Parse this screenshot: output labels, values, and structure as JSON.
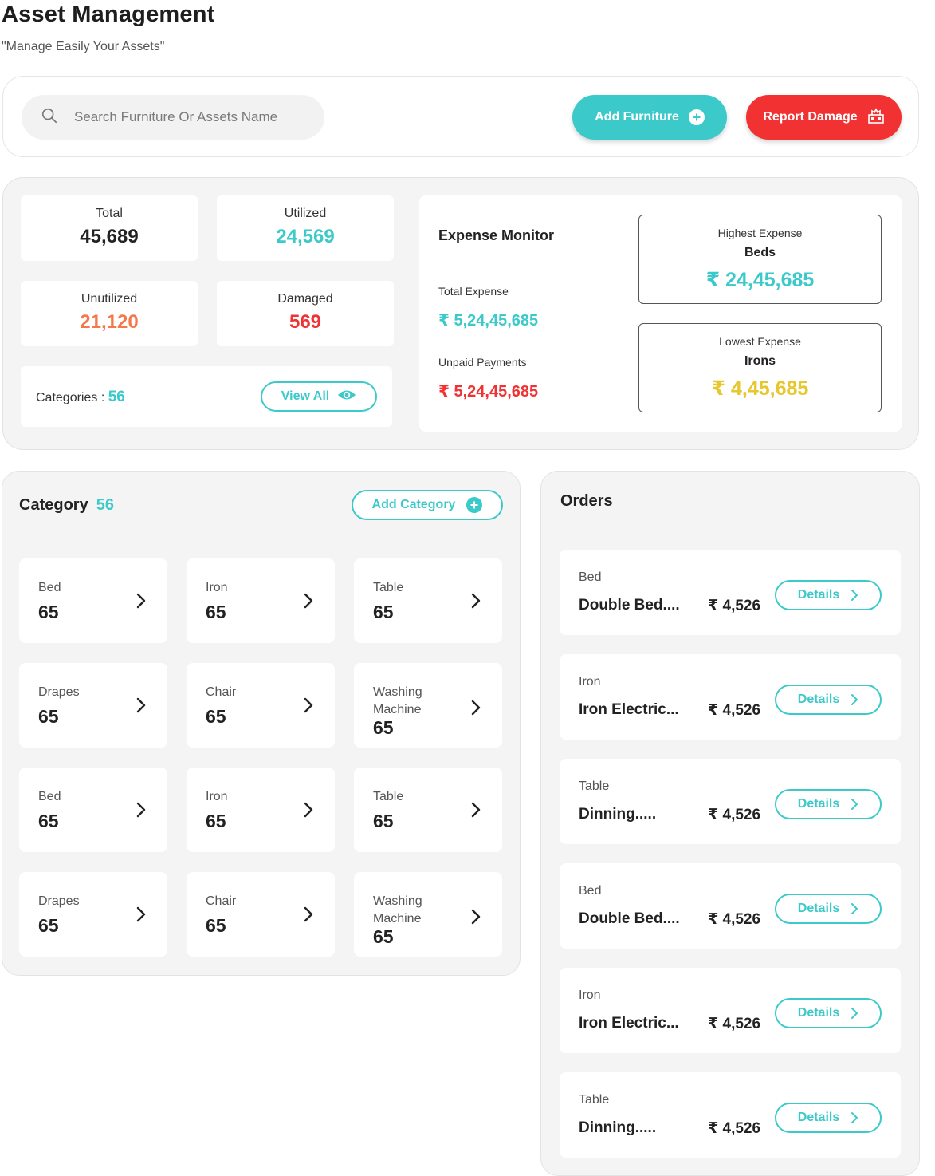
{
  "header": {
    "title": "Asset Management",
    "subtitle": "\"Manage Easily Your Assets\""
  },
  "toolbar": {
    "search_placeholder": "Search Furniture Or Assets Name",
    "add_furniture_label": "Add Furniture",
    "report_damage_label": "Report Damage"
  },
  "stats": {
    "total": {
      "label": "Total",
      "value": "45,689",
      "color": "#222222"
    },
    "utilized": {
      "label": "Utilized",
      "value": "24,569",
      "color": "#3cc9c9"
    },
    "unutilized": {
      "label": "Unutilized",
      "value": "21,120",
      "color": "#f5784a"
    },
    "damaged": {
      "label": "Damaged",
      "value": "569",
      "color": "#f23232"
    },
    "categories_label": "Categories : ",
    "categories_count": "56",
    "view_all_label": "View All"
  },
  "expense": {
    "title": "Expense Monitor",
    "total_label": "Total Expense",
    "total_value": "₹ 5,24,45,685",
    "unpaid_label": "Unpaid Payments",
    "unpaid_value": "₹ 5,24,45,685",
    "highest": {
      "label": "Highest Expense",
      "item": "Beds",
      "value": "₹ 24,45,685",
      "color": "#3cc9c9"
    },
    "lowest": {
      "label": "Lowest Expense",
      "item": "Irons",
      "value": "₹ 4,45,685",
      "color": "#e6c72e"
    }
  },
  "category": {
    "title": "Category",
    "count": "56",
    "add_label": "Add Category",
    "items": [
      {
        "name": "Bed",
        "count": "65"
      },
      {
        "name": "Iron",
        "count": "65"
      },
      {
        "name": "Table",
        "count": "65"
      },
      {
        "name": "Drapes",
        "count": "65"
      },
      {
        "name": "Chair",
        "count": "65"
      },
      {
        "name": "Washing Machine",
        "count": "65"
      },
      {
        "name": "Bed",
        "count": "65"
      },
      {
        "name": "Iron",
        "count": "65"
      },
      {
        "name": "Table",
        "count": "65"
      },
      {
        "name": "Drapes",
        "count": "65"
      },
      {
        "name": "Chair",
        "count": "65"
      },
      {
        "name": "Washing Machine",
        "count": "65"
      }
    ]
  },
  "orders": {
    "title": "Orders",
    "details_label": "Details",
    "items": [
      {
        "category": "Bed",
        "name": "Double Bed....",
        "price": "₹ 4,526"
      },
      {
        "category": "Iron",
        "name": "Iron Electric...",
        "price": "₹ 4,526"
      },
      {
        "category": "Table",
        "name": "Dinning.....",
        "price": "₹ 4,526"
      },
      {
        "category": "Bed",
        "name": "Double Bed....",
        "price": "₹ 4,526"
      },
      {
        "category": "Iron",
        "name": "Iron Electric...",
        "price": "₹ 4,526"
      },
      {
        "category": "Table",
        "name": "Dinning.....",
        "price": "₹ 4,526"
      }
    ]
  },
  "colors": {
    "accent": "#3cc9c9",
    "danger": "#f23232",
    "warning": "#f5784a",
    "gold": "#e6c72e"
  }
}
